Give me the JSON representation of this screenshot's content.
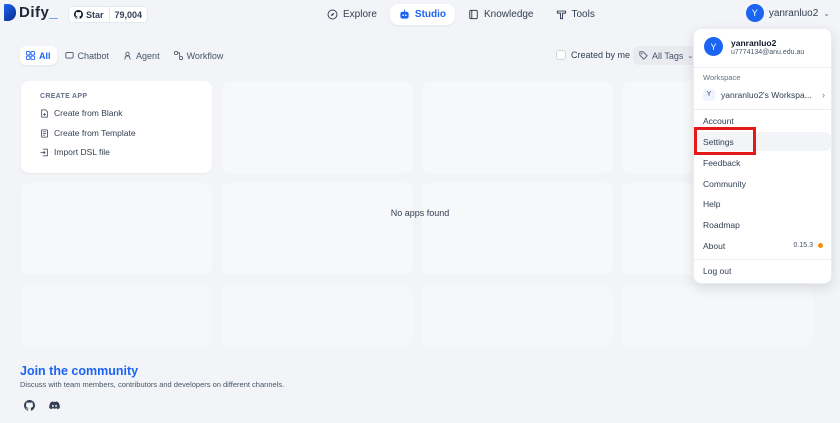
{
  "header": {
    "logo_text": "Dify",
    "star_label": "Star",
    "star_count": "79,004",
    "nav": [
      {
        "label": "Explore",
        "icon": "compass-icon"
      },
      {
        "label": "Studio",
        "icon": "robot-icon"
      },
      {
        "label": "Knowledge",
        "icon": "book-icon"
      },
      {
        "label": "Tools",
        "icon": "tool-icon"
      }
    ],
    "user": {
      "initial": "Y",
      "name": "yanranluo2"
    }
  },
  "filters": {
    "tabs": [
      "All",
      "Chatbot",
      "Agent",
      "Workflow"
    ],
    "created_by_me": "Created by me",
    "all_tags": "All Tags"
  },
  "create_app": {
    "title": "CREATE APP",
    "options": [
      "Create from Blank",
      "Create from Template",
      "Import DSL file"
    ]
  },
  "empty_state": "No apps found",
  "community": {
    "title": "Join the community",
    "description": "Discuss with team members, contributors and developers on different channels."
  },
  "menu": {
    "name": "yanranluo2",
    "email": "u7774134@anu.edu.au",
    "workspace_label": "Workspace",
    "workspace_initial": "Y",
    "workspace_name": "yanranluo2's Workspa...",
    "items": [
      "Account",
      "Settings",
      "Feedback",
      "Community",
      "Help",
      "Roadmap",
      "About",
      "Log out"
    ],
    "version": "0.15.3"
  },
  "colors": {
    "accent": "#1c64f2",
    "highlight": "#e51919",
    "status_dot": "#f79009"
  }
}
